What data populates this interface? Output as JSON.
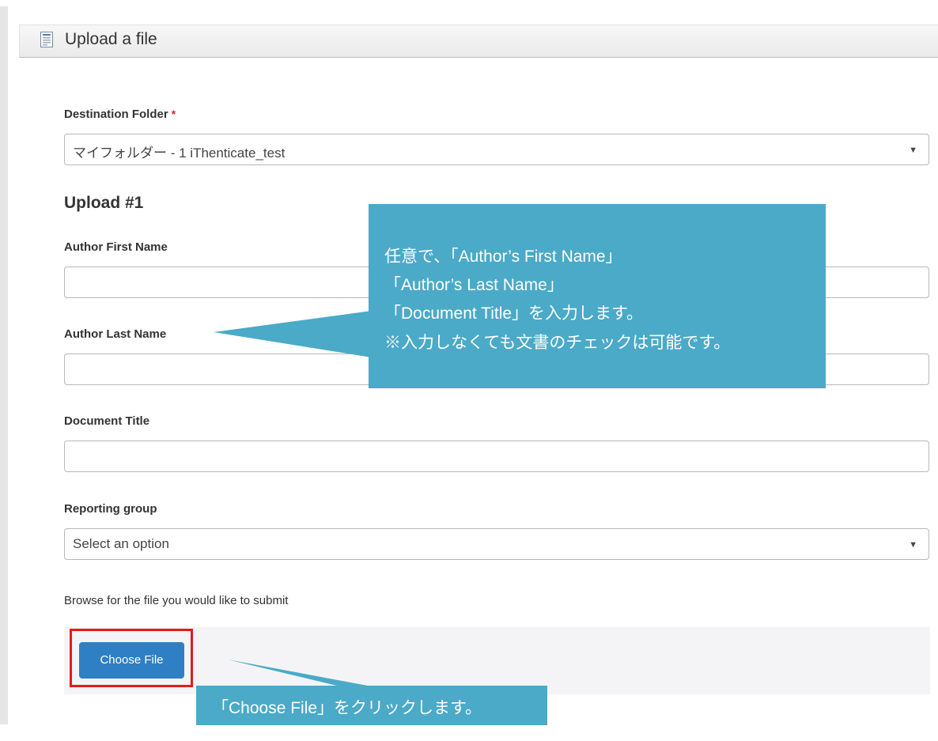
{
  "header": {
    "title": "Upload a file",
    "icon": "document-icon"
  },
  "destination": {
    "label": "Destination Folder",
    "required_mark": "*",
    "value": "マイフォルダー - 1 iThenticate_test",
    "caret": "▼"
  },
  "upload": {
    "heading": "Upload #1",
    "author_first": {
      "label": "Author First Name",
      "value": ""
    },
    "author_last": {
      "label": "Author Last Name",
      "value": ""
    },
    "document_title": {
      "label": "Document Title",
      "value": ""
    },
    "reporting_group": {
      "label": "Reporting group",
      "value": "Select an option",
      "caret": "▼"
    },
    "browse_text": "Browse for the file you would like to submit",
    "choose_file": "Choose File"
  },
  "callouts": {
    "fields_note": {
      "line1": "任意で、「Author’s First Name」",
      "line2": "「Author’s Last Name」",
      "line3": "「Document Title」を入力します。",
      "line4": "※入力しなくても文書のチェックは可能です。"
    },
    "choose_note": "「Choose File」をクリックします。"
  },
  "colors": {
    "accent": "#2f7fc4",
    "callout": "#4aaac8",
    "highlight": "#e31b1b",
    "required": "#d9232e"
  }
}
